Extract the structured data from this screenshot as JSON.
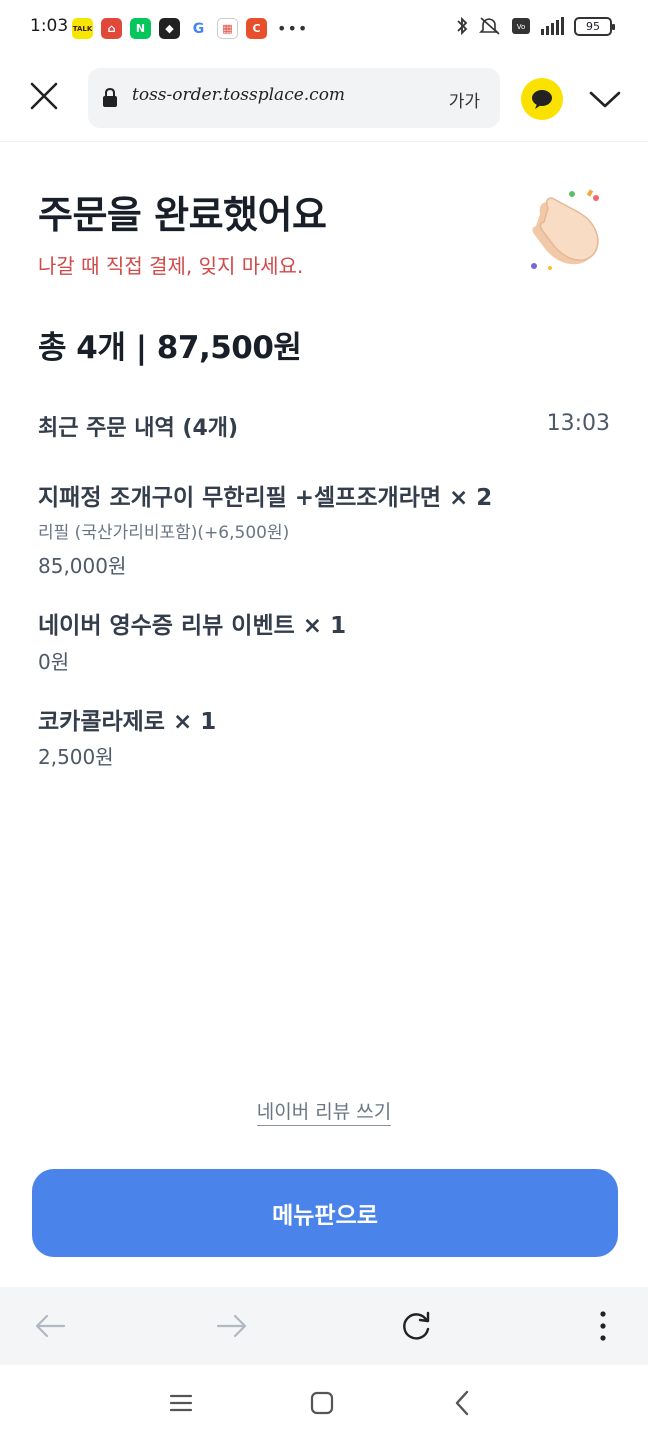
{
  "status_bar": {
    "time": "1:03",
    "apps": [
      {
        "icon": "kakaotalk-icon",
        "label": "TALK",
        "color": "#f7e600"
      },
      {
        "icon": "home-app-icon",
        "label": "",
        "color": "#e0493a"
      },
      {
        "icon": "naver-icon",
        "label": "N",
        "color": "#03c75a"
      },
      {
        "icon": "game-app-icon",
        "label": "",
        "color": "#222222"
      },
      {
        "icon": "google-icon",
        "label": "G",
        "color": "#ffffff"
      },
      {
        "icon": "calendar-app-icon",
        "label": "",
        "color": "#ffffff"
      },
      {
        "icon": "c-app-icon",
        "label": "C",
        "color": "#e8502c"
      }
    ],
    "more": "•••",
    "battery": "95"
  },
  "browser": {
    "url": "toss-order.tossplace.com",
    "text_size_label": "가가"
  },
  "order": {
    "title": "주문을 완료했어요",
    "notice": "나갈 때 직접 결제, 잊지 마세요.",
    "total": "총 4개 | 87,500원",
    "recent_title": "최근 주문 내역 (4개)",
    "recent_time": "13:03",
    "items": [
      {
        "name": "지패정 조개구이 무한리필 +셀프조개라면 × 2",
        "option": "리필 (국산가리비포함)(+6,500원)",
        "price": "85,000원"
      },
      {
        "name": "네이버 영수증 리뷰 이벤트 × 1",
        "option": "",
        "price": "0원"
      },
      {
        "name": "코카콜라제로 × 1",
        "option": "",
        "price": "2,500원"
      }
    ]
  },
  "actions": {
    "review_link": "네이버 리뷰 쓰기",
    "menu_button": "메뉴판으로"
  },
  "colors": {
    "accent": "#4a83ea",
    "notice": "#d04a4a",
    "kakao": "#fae100"
  }
}
